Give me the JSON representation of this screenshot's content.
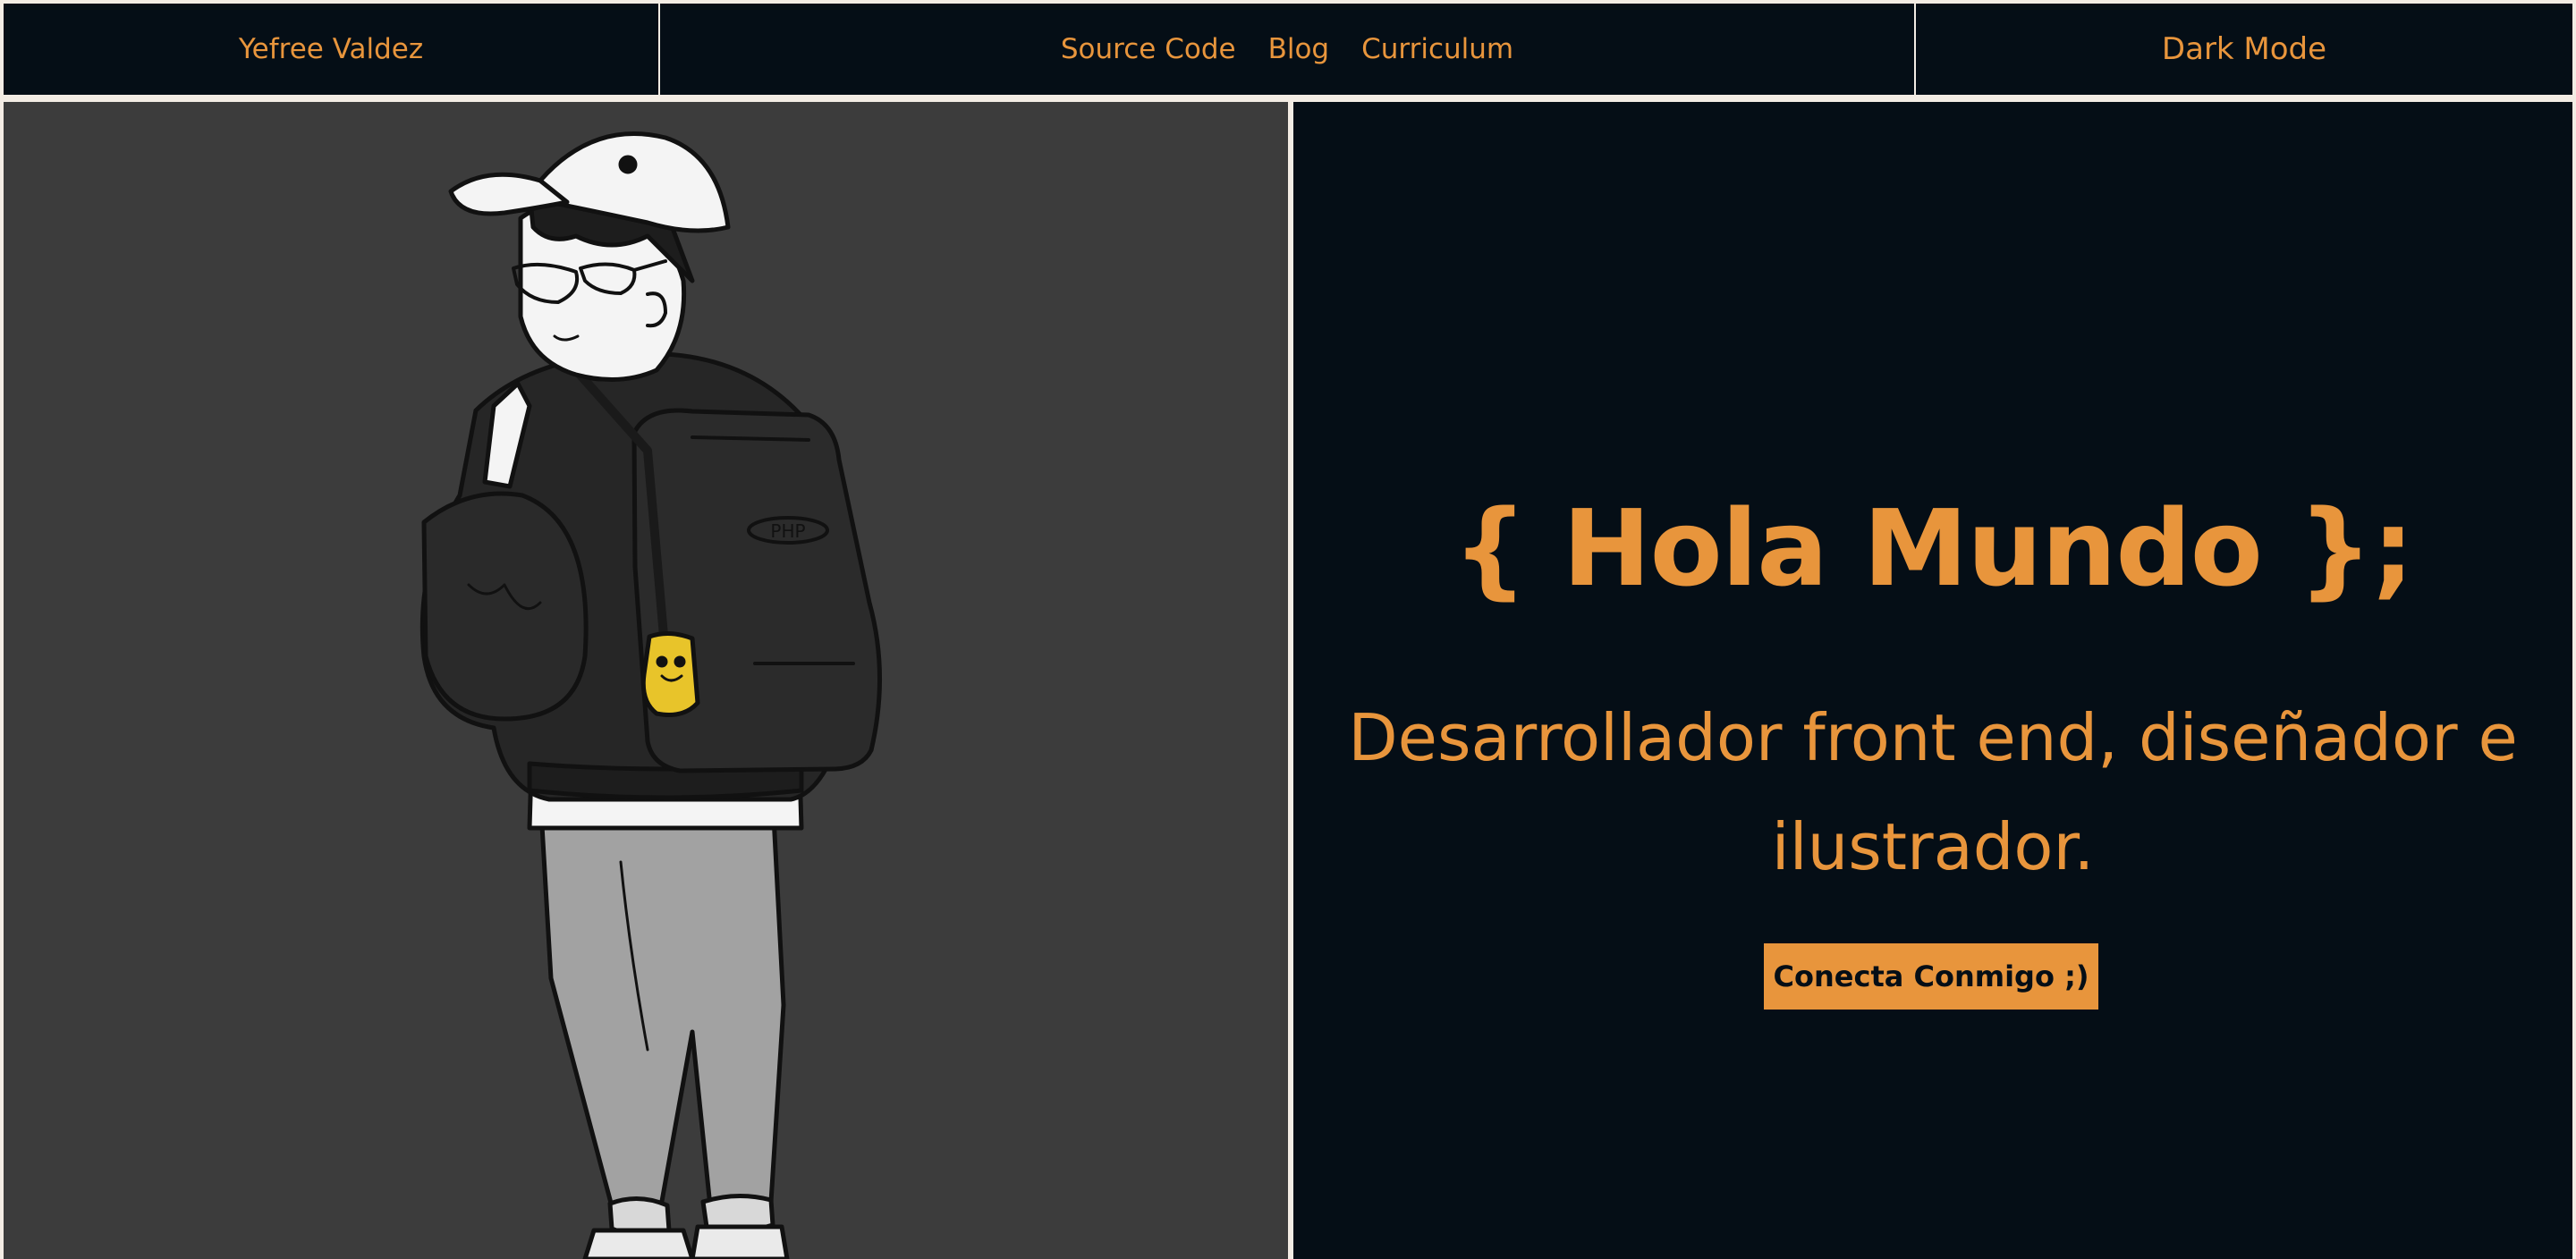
{
  "nav": {
    "brand": "Yefree Valdez",
    "links": [
      "Source Code",
      "Blog",
      "Curriculum"
    ],
    "theme_toggle": "Dark Mode"
  },
  "hero": {
    "title": "{ Hola Mundo };",
    "subtitle": "Desarrollador front end, diseñador e ilustrador.",
    "cta_label": "Conecta Conmigo ;)",
    "illustration": {
      "icon": "character-with-backpack-illustration",
      "backpack_patch_text": "PHP"
    }
  },
  "colors": {
    "accent": "#e8953c",
    "dark_bg": "#050e16",
    "illustration_bg": "#3c3c3c",
    "frame": "#f3ece4"
  }
}
